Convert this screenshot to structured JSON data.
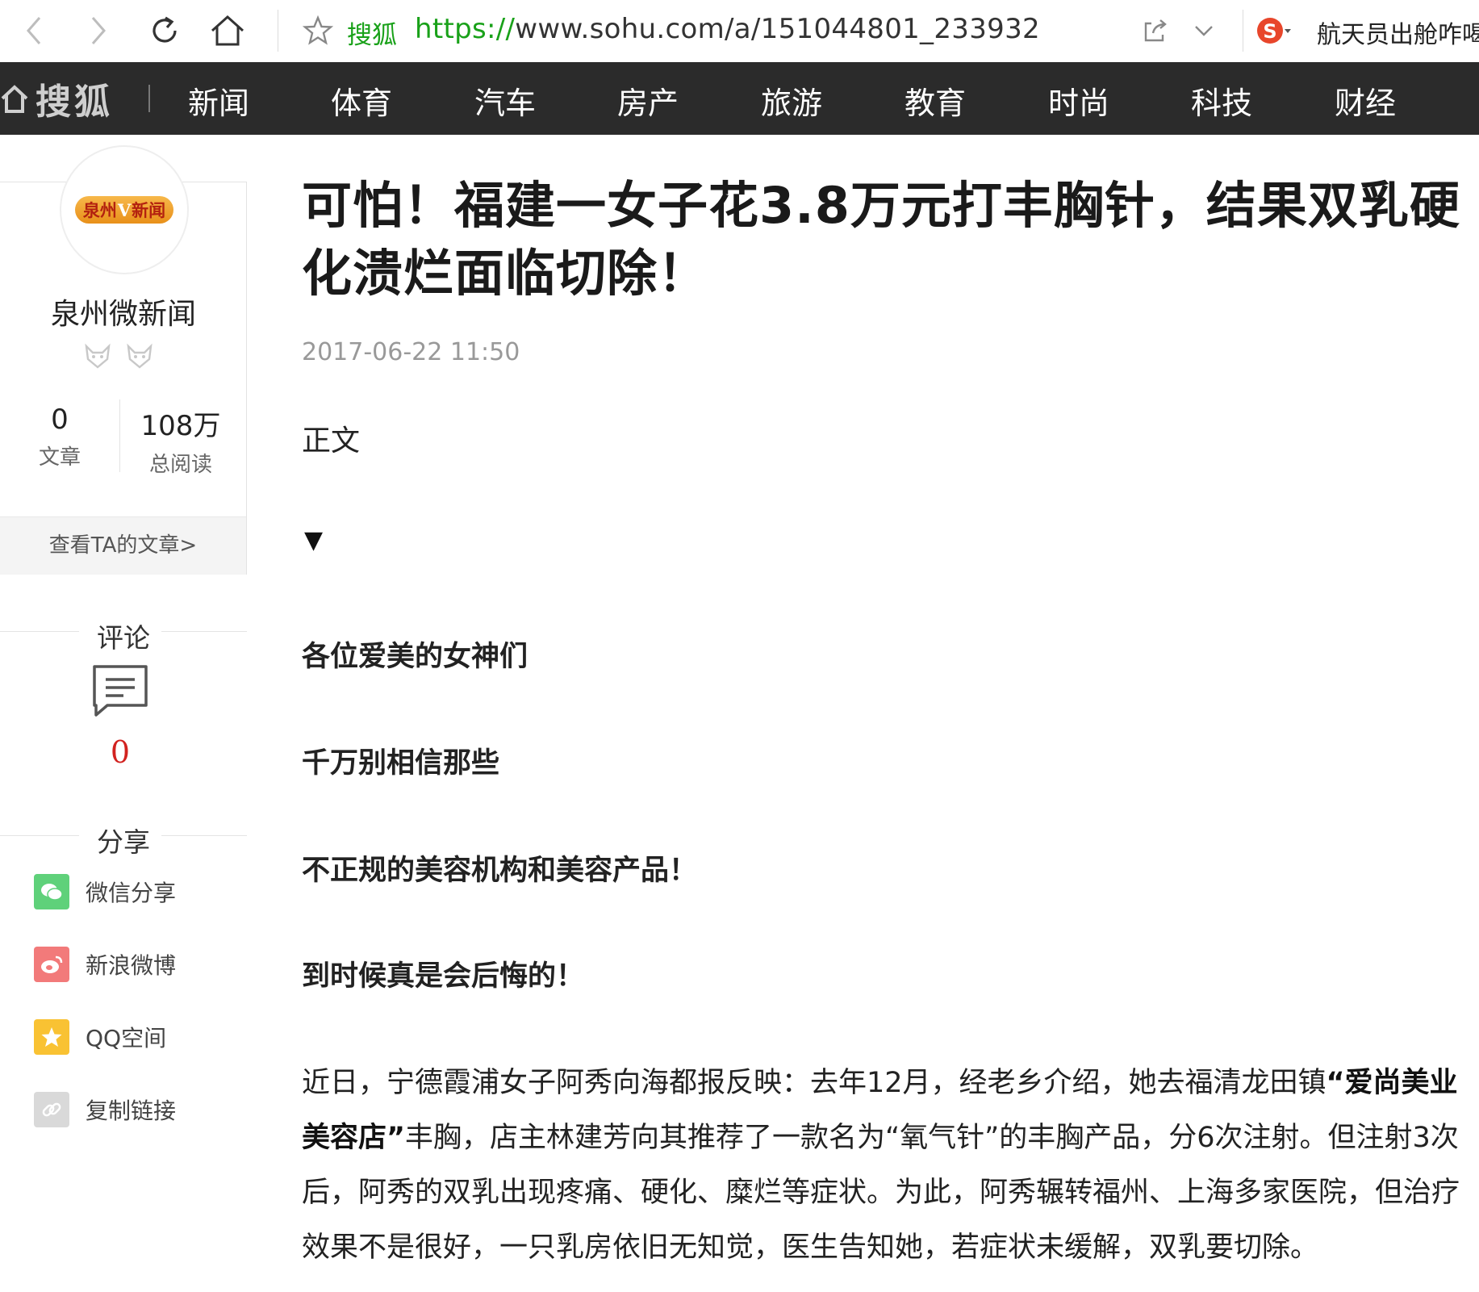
{
  "browser": {
    "site_name": "搜狐",
    "url_protocol": "https://",
    "url_rest": "www.sohu.com/a/151044801_233932",
    "search_text": "航天员出舱咋喝"
  },
  "nav": {
    "logo": "搜狐",
    "items": [
      "新闻",
      "体育",
      "汽车",
      "房产",
      "旅游",
      "教育",
      "时尚",
      "科技",
      "财经"
    ]
  },
  "author": {
    "avatar_text_left": "泉州",
    "avatar_text_v": "V",
    "avatar_text_right": "新闻",
    "name": "泉州微新闻",
    "articles_count": "0",
    "articles_label": "文章",
    "reads_count": "108万",
    "reads_label": "总阅读",
    "view_articles": "查看TA的文章>"
  },
  "comments": {
    "title": "评论",
    "count": "0"
  },
  "share": {
    "title": "分享",
    "items": [
      {
        "label": "微信分享",
        "icon": "wechat-icon",
        "color": "#5fd17a"
      },
      {
        "label": "新浪微博",
        "icon": "weibo-icon",
        "color": "#f27a7a"
      },
      {
        "label": "QQ空间",
        "icon": "qzone-icon",
        "color": "#f9c233"
      },
      {
        "label": "复制链接",
        "icon": "link-icon",
        "color": "#d9d9d9"
      }
    ]
  },
  "article": {
    "title": "可怕！福建一女子花3.8万元打丰胸针，结果双乳硬化溃烂面临切除！",
    "date": "2017-06-22 11:50",
    "zhengwen": "正文",
    "arrow": "▼",
    "bold_lines": [
      "各位爱美的女神们",
      "千万别相信那些",
      "不正规的美容机构和美容产品！",
      "到时候真是会后悔的！"
    ],
    "para_part1": "近日，宁德霞浦女子阿秀向海都报反映：去年12月，经老乡介绍，她去福清龙田镇",
    "para_bold": "“爱尚美业美容店”",
    "para_part2": "丰胸，店主林建芳向其推荐了一款名为“氧气针”的丰胸产品，分6次注射。但注射3次后，阿秀的双乳出现疼痛、硬化、糜烂等症状。为此，阿秀辗转福州、上海多家医院，但治疗效果不是很好，一只乳房依旧无知觉，医生告知她，若症状未缓解，双乳要切除。"
  }
}
